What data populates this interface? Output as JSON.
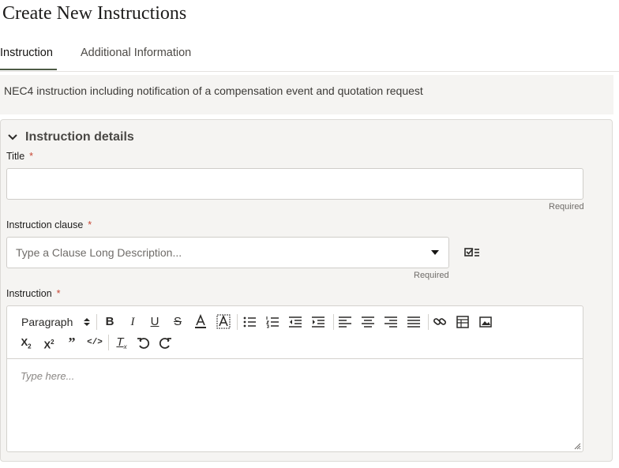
{
  "page": {
    "title": "Create New Instructions"
  },
  "tabs": [
    {
      "label": "Instruction",
      "active": true
    },
    {
      "label": "Additional Information",
      "active": false
    }
  ],
  "description": "NEC4 instruction including notification of a compensation event and quotation request",
  "section": {
    "title": "Instruction details",
    "expanded": true,
    "fields": {
      "title": {
        "label": "Title",
        "required_mark": "*",
        "value": "",
        "hint": "Required"
      },
      "clause": {
        "label": "Instruction clause",
        "required_mark": "*",
        "placeholder": "Type a Clause Long Description...",
        "hint": "Required",
        "button_icon": "checklist-icon"
      },
      "instruction": {
        "label": "Instruction",
        "required_mark": "*",
        "placeholder": "Type here..."
      }
    }
  },
  "editor_toolbar": {
    "format_select": "Paragraph",
    "buttons": [
      "bold",
      "italic",
      "underline",
      "strikethrough",
      "font-color",
      "highlight",
      "bulleted-list",
      "numbered-list",
      "outdent",
      "indent",
      "align-left",
      "align-center",
      "align-right",
      "justify",
      "link",
      "table",
      "image",
      "subscript",
      "superscript",
      "blockquote",
      "code",
      "clear-formatting",
      "undo",
      "redo"
    ]
  },
  "colors": {
    "accent": "#4d5b45",
    "required": "#c74634",
    "panel_bg": "#f5f4f2"
  }
}
